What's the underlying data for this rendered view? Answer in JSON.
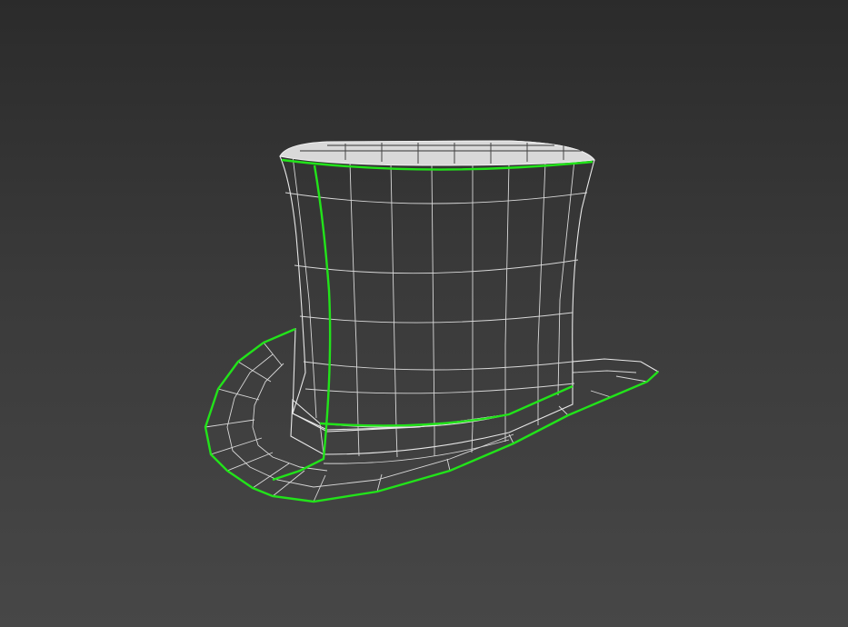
{
  "viewport": {
    "background_top": "#2b2b2b",
    "background_bottom": "#474747"
  },
  "model": {
    "name_icon": "top-hat-mesh",
    "shading": "dark-textured",
    "wire_color": "#e8e8e8",
    "selected_edge_color": "#22e31a",
    "face_color": "#111111"
  }
}
